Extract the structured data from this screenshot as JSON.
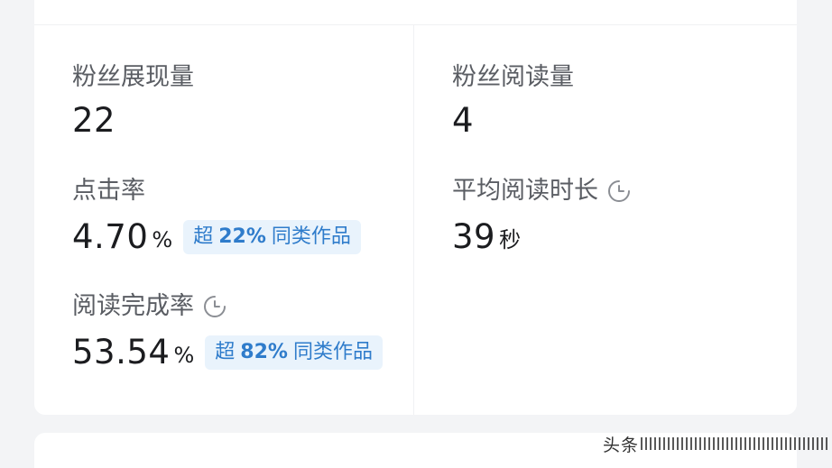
{
  "metrics": {
    "fan_impressions": {
      "label": "粉丝展现量",
      "value": "22"
    },
    "fan_reads": {
      "label": "粉丝阅读量",
      "value": "4"
    },
    "ctr": {
      "label": "点击率",
      "value": "4.70",
      "unit": "%",
      "badge": {
        "prefix": "超",
        "pct": "22%",
        "suffix": "同类作品"
      }
    },
    "avg_read_time": {
      "label": "平均阅读时长",
      "value": "39",
      "unit": "秒",
      "icon": "clock-icon"
    },
    "completion_rate": {
      "label": "阅读完成率",
      "value": "53.54",
      "unit": "%",
      "icon": "clock-icon",
      "badge": {
        "prefix": "超",
        "pct": "82%",
        "suffix": "同类作品"
      }
    }
  },
  "watermark": {
    "text": "头条"
  },
  "colors": {
    "badge_bg": "#e9f3fc",
    "badge_text": "#2f7ccb",
    "label": "#5a5d63",
    "value": "#1b1c1f"
  }
}
